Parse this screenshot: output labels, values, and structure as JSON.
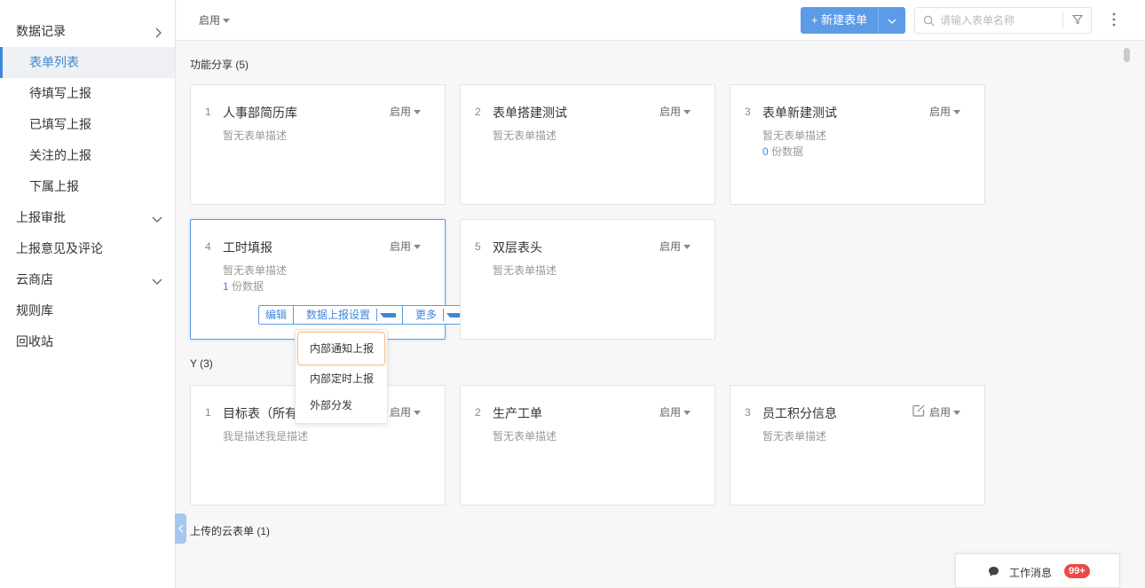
{
  "sidebar": {
    "items": [
      {
        "label": "数据记录",
        "chevron": "right"
      },
      {
        "label": "表单列表",
        "sub": true,
        "active": true
      },
      {
        "label": "待填写上报",
        "sub": true
      },
      {
        "label": "已填写上报",
        "sub": true
      },
      {
        "label": "关注的上报",
        "sub": true
      },
      {
        "label": "下属上报",
        "sub": true
      },
      {
        "label": "上报审批",
        "chevron": "down"
      },
      {
        "label": "上报意见及评论"
      },
      {
        "label": "云商店",
        "chevron": "down"
      },
      {
        "label": "规则库"
      },
      {
        "label": "回收站"
      }
    ]
  },
  "topbar": {
    "status_filter": "启用",
    "new_form_label": "+ 新建表单",
    "search_placeholder": "请输入表单名称"
  },
  "sections": [
    {
      "title": "功能分享 (5)",
      "cards": [
        {
          "num": "1",
          "name": "人事部简历库",
          "status": "启用",
          "desc": "暂无表单描述"
        },
        {
          "num": "2",
          "name": "表单搭建测试",
          "status": "启用",
          "desc": "暂无表单描述"
        },
        {
          "num": "3",
          "name": "表单新建测试",
          "status": "启用",
          "desc": "暂无表单描述",
          "count_num": "0",
          "count_text": " 份数据"
        },
        {
          "num": "4",
          "name": "工时填报",
          "status": "启用",
          "desc": "暂无表单描述",
          "count_num": "1",
          "count_text": " 份数据"
        },
        {
          "num": "5",
          "name": "双层表头",
          "status": "启用",
          "desc": "暂无表单描述"
        }
      ]
    },
    {
      "title": "Y (3)",
      "cards": [
        {
          "num": "1",
          "name": "目标表（所有",
          "status": "启用",
          "desc": "我是描述我是描述"
        },
        {
          "num": "2",
          "name": "生产工单",
          "status": "启用",
          "desc": "暂无表单描述"
        },
        {
          "num": "3",
          "name": "员工积分信息",
          "status": "启用",
          "desc": "暂无表单描述"
        }
      ]
    },
    {
      "title": "上传的云表单 (1)"
    }
  ],
  "card_actions": {
    "edit": "编辑",
    "report_settings": "数据上报设置",
    "more": "更多"
  },
  "dropdown": {
    "options": [
      "内部通知上报",
      "内部定时上报",
      "外部分发"
    ]
  },
  "messages": {
    "label": "工作消息",
    "badge": "99+"
  }
}
